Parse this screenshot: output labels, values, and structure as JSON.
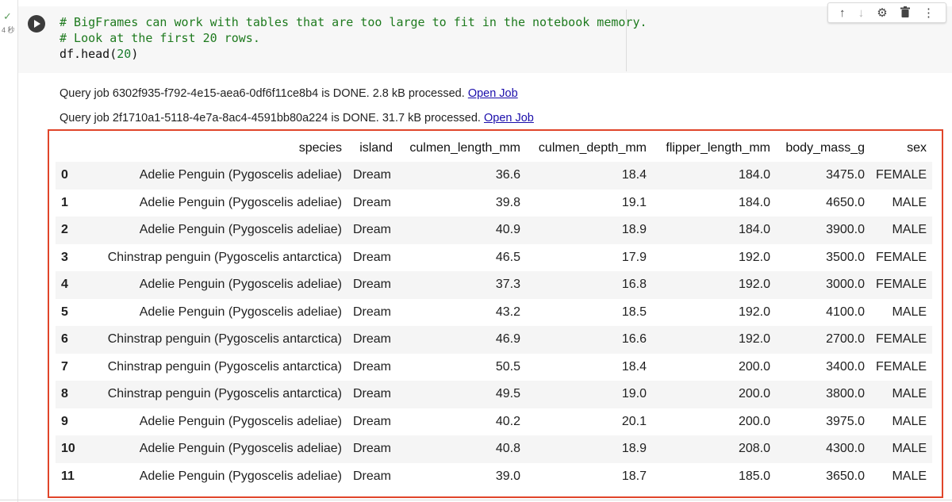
{
  "cell": {
    "exec_status": "✓",
    "exec_time": "4 秒",
    "code_lines": [
      "# BigFrames can work with tables that are too large to fit in the notebook memory.",
      "# Look at the first 20 rows."
    ],
    "code_call_prefix": "df.head(",
    "code_call_arg": "20",
    "code_call_suffix": ")"
  },
  "toolbar": {
    "up_icon": "↑",
    "down_icon": "↓",
    "settings_icon": "⚙",
    "delete_icon": "🗑",
    "more_icon": "⋮"
  },
  "output": {
    "query_lines": [
      {
        "text": "Query job 6302f935-f792-4e15-aea6-0df6f11ce8b4 is DONE. 2.8 kB processed. ",
        "link": "Open Job"
      },
      {
        "text": "Query job 2f1710a1-5118-4e7a-8ac4-4591bb80a224 is DONE. 31.7 kB processed. ",
        "link": "Open Job"
      }
    ]
  },
  "table": {
    "columns": [
      "",
      "species",
      "island",
      "culmen_length_mm",
      "culmen_depth_mm",
      "flipper_length_mm",
      "body_mass_g",
      "sex"
    ],
    "rows": [
      [
        "0",
        "Adelie Penguin (Pygoscelis adeliae)",
        "Dream",
        "36.6",
        "18.4",
        "184.0",
        "3475.0",
        "FEMALE"
      ],
      [
        "1",
        "Adelie Penguin (Pygoscelis adeliae)",
        "Dream",
        "39.8",
        "19.1",
        "184.0",
        "4650.0",
        "MALE"
      ],
      [
        "2",
        "Adelie Penguin (Pygoscelis adeliae)",
        "Dream",
        "40.9",
        "18.9",
        "184.0",
        "3900.0",
        "MALE"
      ],
      [
        "3",
        "Chinstrap penguin (Pygoscelis antarctica)",
        "Dream",
        "46.5",
        "17.9",
        "192.0",
        "3500.0",
        "FEMALE"
      ],
      [
        "4",
        "Adelie Penguin (Pygoscelis adeliae)",
        "Dream",
        "37.3",
        "16.8",
        "192.0",
        "3000.0",
        "FEMALE"
      ],
      [
        "5",
        "Adelie Penguin (Pygoscelis adeliae)",
        "Dream",
        "43.2",
        "18.5",
        "192.0",
        "4100.0",
        "MALE"
      ],
      [
        "6",
        "Chinstrap penguin (Pygoscelis antarctica)",
        "Dream",
        "46.9",
        "16.6",
        "192.0",
        "2700.0",
        "FEMALE"
      ],
      [
        "7",
        "Chinstrap penguin (Pygoscelis antarctica)",
        "Dream",
        "50.5",
        "18.4",
        "200.0",
        "3400.0",
        "FEMALE"
      ],
      [
        "8",
        "Chinstrap penguin (Pygoscelis antarctica)",
        "Dream",
        "49.5",
        "19.0",
        "200.0",
        "3800.0",
        "MALE"
      ],
      [
        "9",
        "Adelie Penguin (Pygoscelis adeliae)",
        "Dream",
        "40.2",
        "20.1",
        "200.0",
        "3975.0",
        "MALE"
      ],
      [
        "10",
        "Adelie Penguin (Pygoscelis adeliae)",
        "Dream",
        "40.8",
        "18.9",
        "208.0",
        "4300.0",
        "MALE"
      ],
      [
        "11",
        "Adelie Penguin (Pygoscelis adeliae)",
        "Dream",
        "39.0",
        "18.7",
        "185.0",
        "3650.0",
        "MALE"
      ]
    ]
  },
  "colors": {
    "highlight_border": "#e0452a",
    "comment_green": "#1e7a1e",
    "link_blue": "#1a0dab"
  }
}
